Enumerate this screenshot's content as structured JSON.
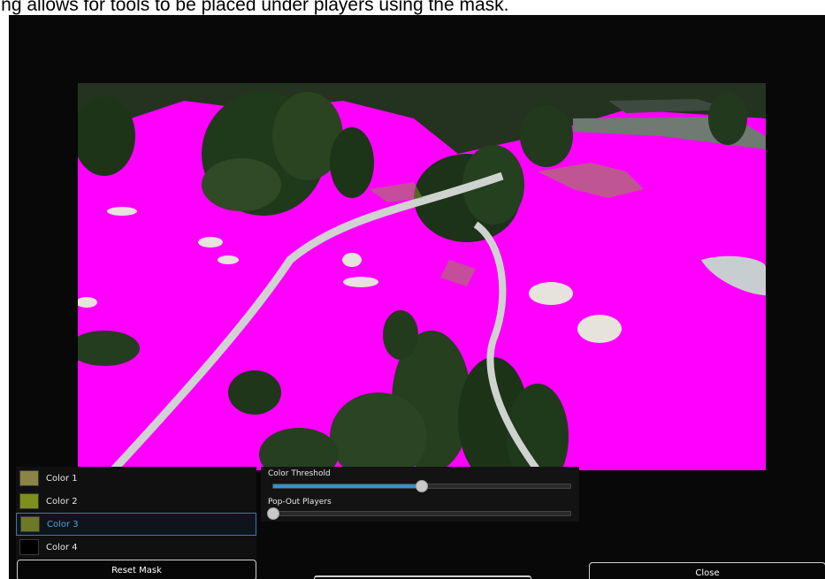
{
  "caption": "king allows for tools to be placed under players using the mask.",
  "colors": {
    "mask": "#ff00ff",
    "accent": "#2f95c9",
    "selected_border": "#2f7fb0"
  },
  "swatches": [
    {
      "label": "Color 1",
      "color": "#8a8545"
    },
    {
      "label": "Color 2",
      "color": "#7f8f1c"
    },
    {
      "label": "Color 3",
      "color": "#6b7a24",
      "selected": true
    },
    {
      "label": "Color 4",
      "color": "#000000"
    }
  ],
  "reset_label": "Reset Mask",
  "sliders": [
    {
      "label": "Color Threshold",
      "value": 0.5
    },
    {
      "label": "Pop-Out Players",
      "value": 0.0
    }
  ],
  "close_label": "Close"
}
